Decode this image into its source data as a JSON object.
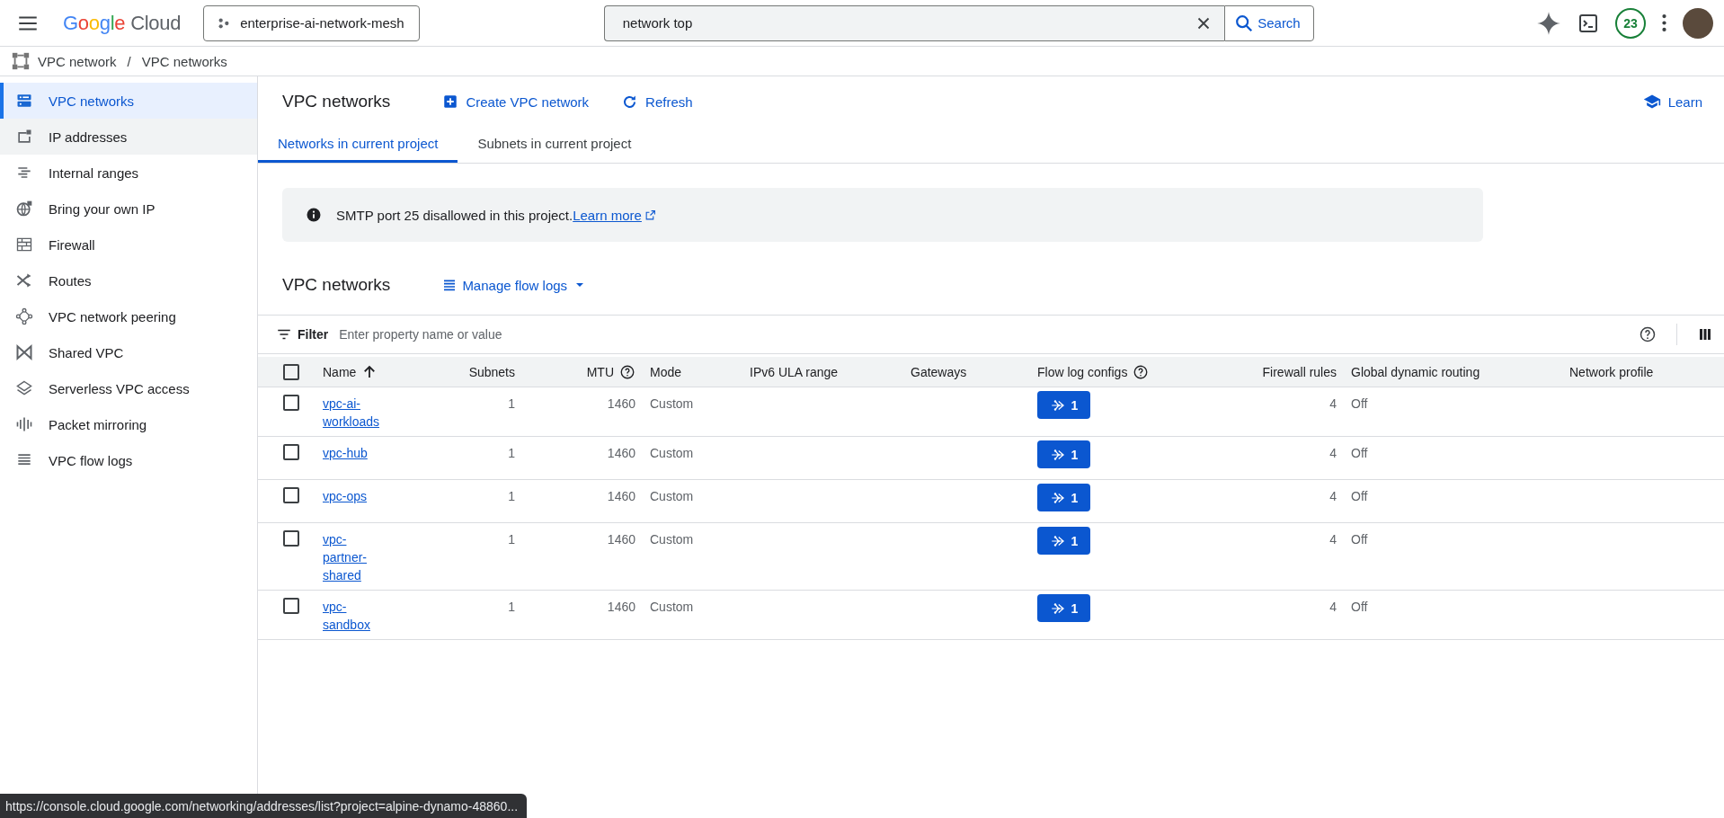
{
  "topbar": {
    "logo_google": "Google",
    "logo_cloud": "Cloud",
    "project": "enterprise-ai-network-mesh",
    "search": {
      "value": "network top",
      "button": "Search"
    },
    "notifications": "23"
  },
  "breadcrumb": {
    "items": [
      "VPC network",
      "VPC networks"
    ],
    "separator": "/"
  },
  "sidebar": {
    "items": [
      {
        "label": "VPC networks",
        "selected": true,
        "hovered": false
      },
      {
        "label": "IP addresses",
        "selected": false,
        "hovered": true
      },
      {
        "label": "Internal ranges",
        "selected": false,
        "hovered": false
      },
      {
        "label": "Bring your own IP",
        "selected": false,
        "hovered": false
      },
      {
        "label": "Firewall",
        "selected": false,
        "hovered": false
      },
      {
        "label": "Routes",
        "selected": false,
        "hovered": false
      },
      {
        "label": "VPC network peering",
        "selected": false,
        "hovered": false
      },
      {
        "label": "Shared VPC",
        "selected": false,
        "hovered": false
      },
      {
        "label": "Serverless VPC access",
        "selected": false,
        "hovered": false
      },
      {
        "label": "Packet mirroring",
        "selected": false,
        "hovered": false
      },
      {
        "label": "VPC flow logs",
        "selected": false,
        "hovered": false
      }
    ]
  },
  "header": {
    "title": "VPC networks",
    "create": "Create VPC network",
    "refresh": "Refresh",
    "learn": "Learn"
  },
  "tabs": [
    {
      "label": "Networks in current project",
      "selected": true
    },
    {
      "label": "Subnets in current project",
      "selected": false
    }
  ],
  "banner": {
    "text": "SMTP port 25 disallowed in this project.",
    "link": "Learn more"
  },
  "section": {
    "title": "VPC networks",
    "action": "Manage flow logs"
  },
  "filter": {
    "label": "Filter",
    "placeholder": "Enter property name or value"
  },
  "table": {
    "select_all": {
      "checked": false
    },
    "columns": [
      {
        "label": "Name",
        "kind": "sort"
      },
      {
        "label": "Subnets",
        "kind": "number"
      },
      {
        "label": "MTU",
        "kind": "number-help"
      },
      {
        "label": "Mode",
        "kind": "text"
      },
      {
        "label": "IPv6 ULA range",
        "kind": "text"
      },
      {
        "label": "Gateways",
        "kind": "text"
      },
      {
        "label": "Flow log configs",
        "kind": "text-help"
      },
      {
        "label": "Firewall rules",
        "kind": "number"
      },
      {
        "label": "Global dynamic routing",
        "kind": "text"
      },
      {
        "label": "Network profile",
        "kind": "text"
      }
    ],
    "rows": [
      {
        "checked": false,
        "name": "vpc-ai-workloads",
        "subnets": "1",
        "mtu": "1460",
        "mode": "Custom",
        "flow_logs": "1",
        "firewall_rules": "4",
        "routing": "Off"
      },
      {
        "checked": false,
        "name": "vpc-hub",
        "subnets": "1",
        "mtu": "1460",
        "mode": "Custom",
        "flow_logs": "1",
        "firewall_rules": "4",
        "routing": "Off"
      },
      {
        "checked": false,
        "name": "vpc-ops",
        "subnets": "1",
        "mtu": "1460",
        "mode": "Custom",
        "flow_logs": "1",
        "firewall_rules": "4",
        "routing": "Off"
      },
      {
        "checked": false,
        "name": "vpc-partner-shared",
        "subnets": "1",
        "mtu": "1460",
        "mode": "Custom",
        "flow_logs": "1",
        "firewall_rules": "4",
        "routing": "Off"
      },
      {
        "checked": false,
        "name": "vpc-sandbox",
        "subnets": "1",
        "mtu": "1460",
        "mode": "Custom",
        "flow_logs": "1",
        "firewall_rules": "4",
        "routing": "Off"
      }
    ]
  },
  "status_url": "https://console.cloud.google.com/networking/addresses/list?project=alpine-dynamo-48860..."
}
